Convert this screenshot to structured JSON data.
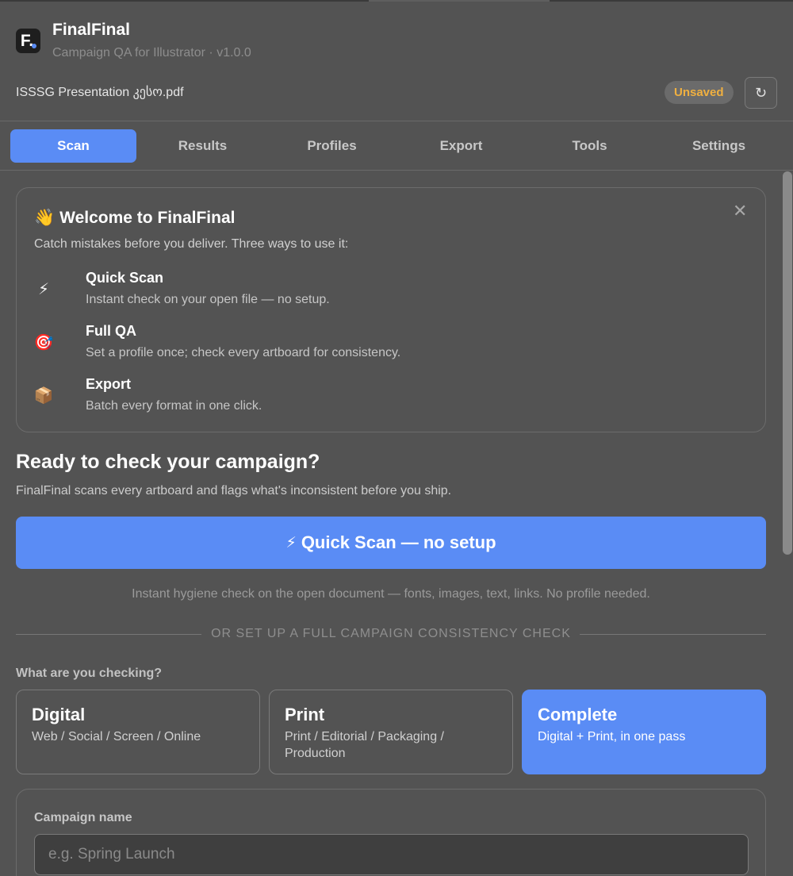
{
  "app": {
    "logo_letter": "F.",
    "title": "FinalFinal",
    "subtitle": "Campaign QA for Illustrator · v1.0.0",
    "file_name": "ISSSG Presentation კესო.pdf",
    "status_badge": "Unsaved",
    "refresh_icon": "↻"
  },
  "tabs": [
    {
      "label": "Scan",
      "active": true
    },
    {
      "label": "Results",
      "active": false
    },
    {
      "label": "Profiles",
      "active": false
    },
    {
      "label": "Export",
      "active": false
    },
    {
      "label": "Tools",
      "active": false
    },
    {
      "label": "Settings",
      "active": false
    }
  ],
  "welcome": {
    "emoji": "👋",
    "title": "Welcome to FinalFinal",
    "close_icon": "✕",
    "subtitle": "Catch mistakes before you deliver. Three ways to use it:",
    "features": [
      {
        "icon": "⚡",
        "icon_name": "lightning-icon",
        "name": "Quick Scan",
        "desc": "Instant check on your open file — no setup."
      },
      {
        "icon": "🎯",
        "icon_name": "target-icon",
        "name": "Full QA",
        "desc": "Set a profile once; check every artboard for consistency."
      },
      {
        "icon": "📦",
        "icon_name": "package-icon",
        "name": "Export",
        "desc": "Batch every format in one click."
      }
    ]
  },
  "ready": {
    "title": "Ready to check your campaign?",
    "subtitle": "FinalFinal scans every artboard and flags what's inconsistent before you ship."
  },
  "quick_scan": {
    "icon": "⚡",
    "label": "Quick Scan — no setup",
    "note": "Instant hygiene check on the open document — fonts, images, text, links. No profile needed."
  },
  "divider_text": "OR SET UP A FULL CAMPAIGN CONSISTENCY CHECK",
  "checking": {
    "label": "What are you checking?",
    "options": [
      {
        "name": "Digital",
        "desc": "Web / Social / Screen / Online",
        "active": false
      },
      {
        "name": "Print",
        "desc": "Print / Editorial / Packaging / Production",
        "active": false
      },
      {
        "name": "Complete",
        "desc": "Digital + Print, in one pass",
        "active": true
      }
    ]
  },
  "campaign": {
    "label": "Campaign name",
    "placeholder": "e.g. Spring Launch",
    "value": ""
  },
  "colors": {
    "accent": "#5a8cf5",
    "background": "#535353",
    "badge_text": "#f0b040"
  }
}
